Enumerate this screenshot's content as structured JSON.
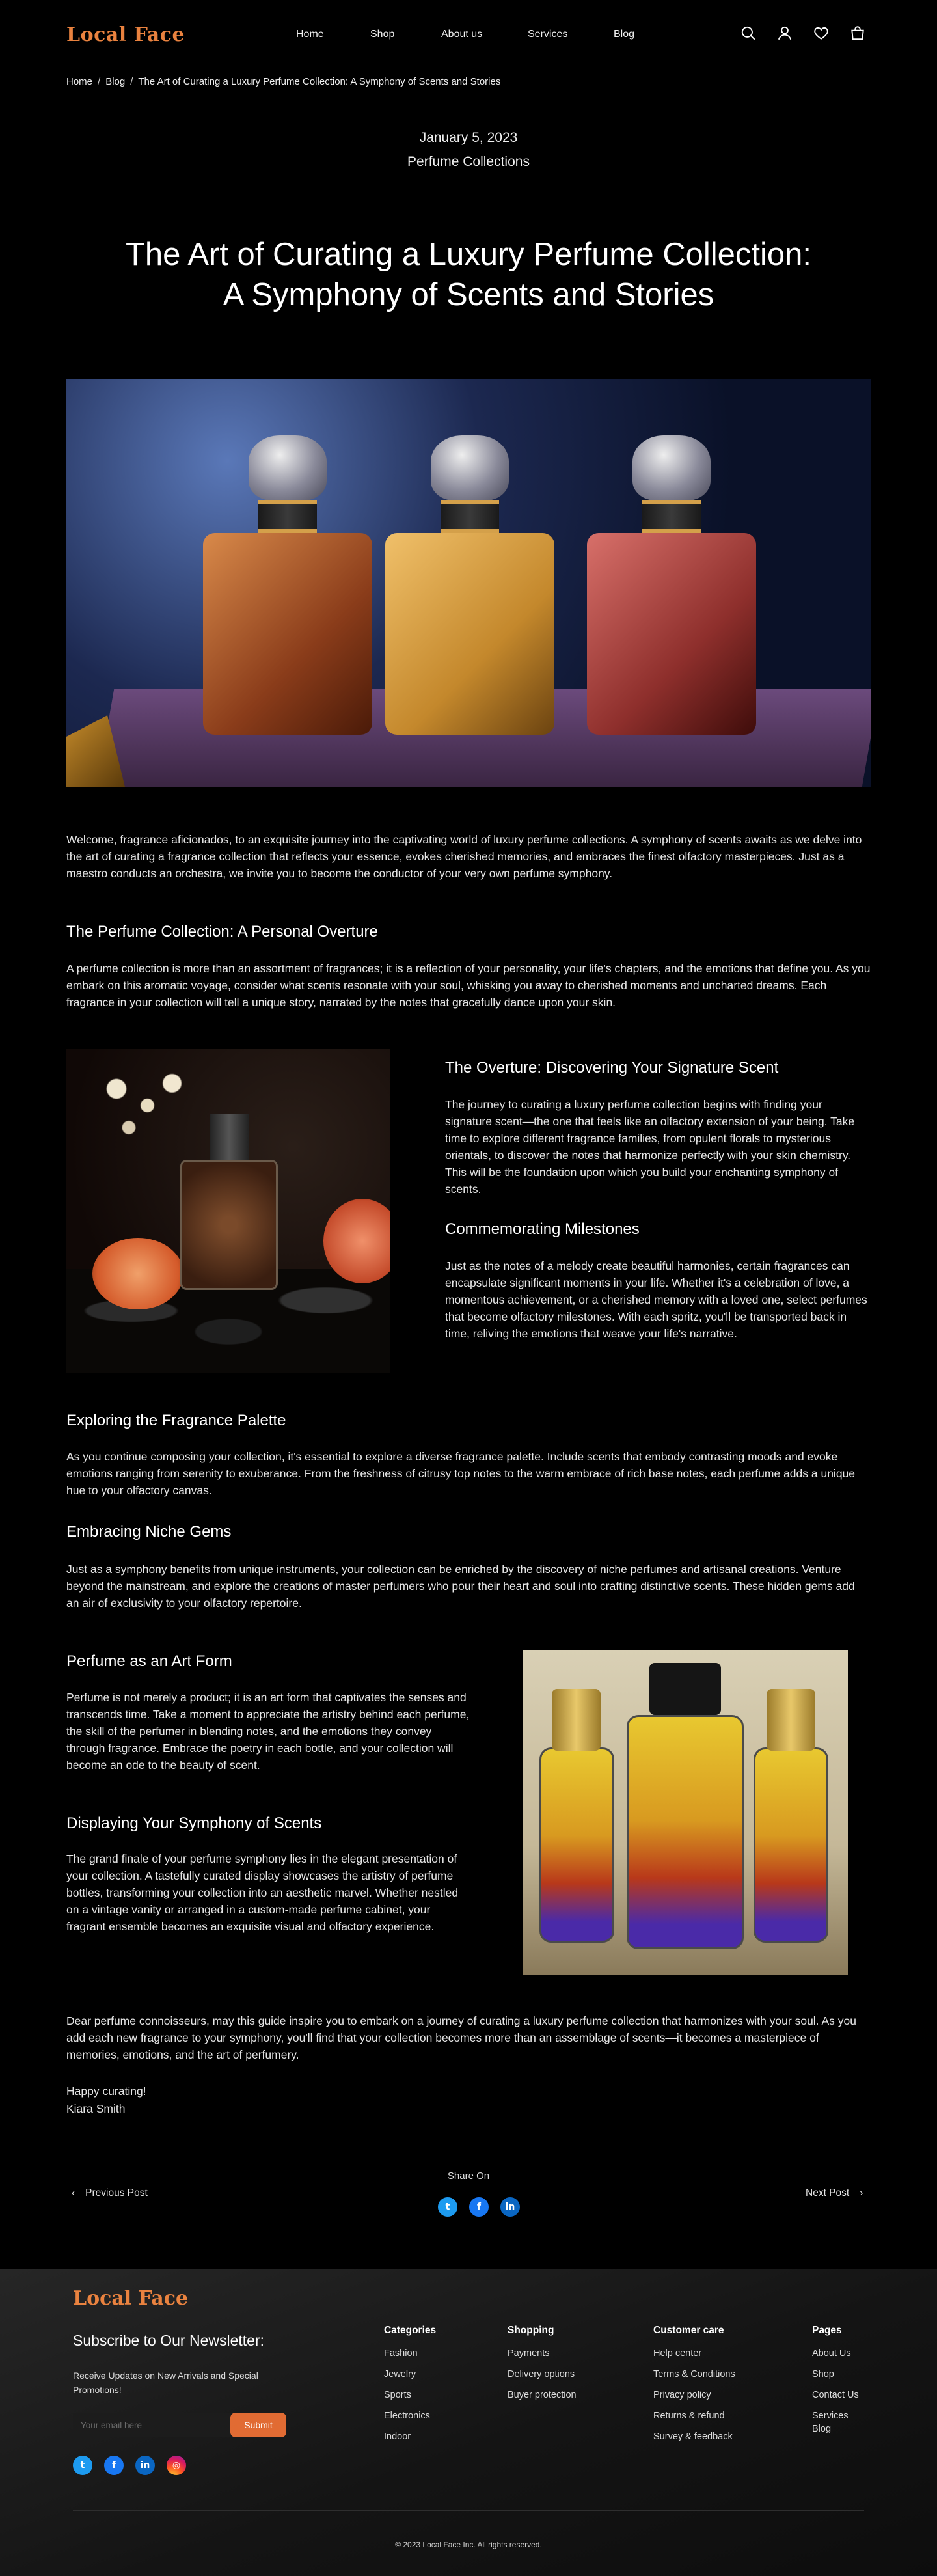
{
  "header": {
    "logo": "Local Face",
    "nav": [
      "Home",
      "Shop",
      "About us",
      "Services",
      "Blog"
    ],
    "icons": [
      "search-icon",
      "user-icon",
      "heart-icon",
      "bag-icon"
    ]
  },
  "breadcrumb": {
    "home": "Home",
    "blog": "Blog",
    "current": "The Art of Curating a Luxury Perfume Collection: A Symphony of Scents and Stories",
    "separator": "/"
  },
  "post": {
    "date": "January 5, 2023",
    "category": "Perfume Collections",
    "title_line1": "The Art of Curating a Luxury Perfume Collection:",
    "title_line2": "A Symphony of Scents and Stories",
    "intro": "Welcome, fragrance aficionados, to an exquisite journey into the captivating world of luxury perfume collections. A symphony of scents awaits as we delve into the art of curating a fragrance collection that reflects your essence, evokes cherished memories, and embraces the finest olfactory masterpieces. Just as a maestro conducts an orchestra, we invite you to become the conductor of your very own perfume symphony.",
    "s1_title": "The Perfume Collection: A Personal Overture",
    "s1_text": "A perfume collection is more than an assortment of fragrances; it is a reflection of your personality, your life's chapters, and the emotions that define you. As you embark on this aromatic voyage, consider what scents resonate with your soul, whisking you away to cherished moments and uncharted dreams. Each fragrance in your collection will tell a unique story, narrated by the notes that gracefully dance upon your skin.",
    "s2_title": "The Overture: Discovering Your Signature Scent",
    "s2_text": "The journey to curating a luxury perfume collection begins with finding your signature scent—the one that feels like an olfactory extension of your being. Take time to explore different fragrance families, from opulent florals to mysterious orientals, to discover the notes that harmonize perfectly with your skin chemistry. This will be the foundation upon which you build your enchanting symphony of scents.",
    "s3_title": "Commemorating Milestones",
    "s3_text": "Just as the notes of a melody create beautiful harmonies, certain fragrances can encapsulate significant moments in your life. Whether it's a celebration of love, a momentous achievement, or a cherished memory with a loved one, select perfumes that become olfactory milestones. With each spritz, you'll be transported back in time, reliving the emotions that weave your life's narrative.",
    "s4_title": "Exploring the Fragrance Palette",
    "s4_text": "As you continue composing your collection, it's essential to explore a diverse fragrance palette. Include scents that embody contrasting moods and evoke emotions ranging from serenity to exuberance. From the freshness of citrusy top notes to the warm embrace of rich base notes, each perfume adds a unique hue to your olfactory canvas.",
    "s5_title": "Embracing Niche Gems",
    "s5_text": "Just as a symphony benefits from unique instruments, your collection can be enriched by the discovery of niche perfumes and artisanal creations. Venture beyond the mainstream, and explore the creations of master perfumers who pour their heart and soul into crafting distinctive scents. These hidden gems add an air of exclusivity to your olfactory repertoire.",
    "s6_title": "Perfume as an Art Form",
    "s6_text": "Perfume is not merely a product; it is an art form that captivates the senses and transcends time. Take a moment to appreciate the artistry behind each perfume, the skill of the perfumer in blending notes, and the emotions they convey through fragrance. Embrace the poetry in each bottle, and your collection will become an ode to the beauty of scent.",
    "s7_title": "Displaying Your Symphony of Scents",
    "s7_text": "The grand finale of your perfume symphony lies in the elegant presentation of your collection. A tastefully curated display showcases the artistry of perfume bottles, transforming your collection into an aesthetic marvel. Whether nestled on a vintage vanity or arranged in a custom-made perfume cabinet, your fragrant ensemble becomes an exquisite visual and olfactory experience.",
    "closing": "Dear perfume connoisseurs, may this guide inspire you to embark on a journey of curating a luxury perfume collection that harmonizes with your soul. As you add each new fragrance to your symphony, you'll find that your collection becomes more than an assemblage of scents—it becomes a masterpiece of memories, emotions, and the art of perfumery.",
    "signoff": "Happy curating!",
    "author": "Kiara Smith"
  },
  "share": {
    "label": "Share On",
    "icons": [
      "twitter-icon",
      "facebook-icon",
      "linkedin-icon"
    ],
    "glyphs": {
      "twitter": "t",
      "facebook": "f",
      "linkedin": "in",
      "instagram": "◎"
    }
  },
  "pager": {
    "prev": "Previous Post",
    "next": "Next Post"
  },
  "footer": {
    "logo": "Local Face",
    "subscribe_title": "Subscribe to Our Newsletter:",
    "subscribe_desc": "Receive Updates on New Arrivals and Special Promotions!",
    "email_placeholder": "Your email here",
    "submit": "Submit",
    "social": [
      "twitter-icon",
      "facebook-icon",
      "linkedin-icon",
      "instagram-icon"
    ],
    "columns": {
      "categories": {
        "title": "Categories",
        "items": [
          "Fashion",
          "Jewelry",
          "Sports",
          "Electronics",
          "Indoor"
        ]
      },
      "shopping": {
        "title": "Shopping",
        "items": [
          "Payments",
          "Delivery options",
          "Buyer protection"
        ]
      },
      "customer_care": {
        "title": "Customer care",
        "items": [
          "Help center",
          "Terms & Conditions",
          "Privacy policy",
          "Returns & refund",
          "Survey & feedback"
        ]
      },
      "pages": {
        "title": "Pages",
        "items": [
          "About Us",
          "Shop",
          "Contact Us",
          "Services",
          "Blog"
        ]
      }
    },
    "copyright": "© 2023 Local Face Inc. All rights reserved."
  },
  "colors": {
    "brand": "#e9823f",
    "button": "#e16b33",
    "background": "#000000"
  }
}
